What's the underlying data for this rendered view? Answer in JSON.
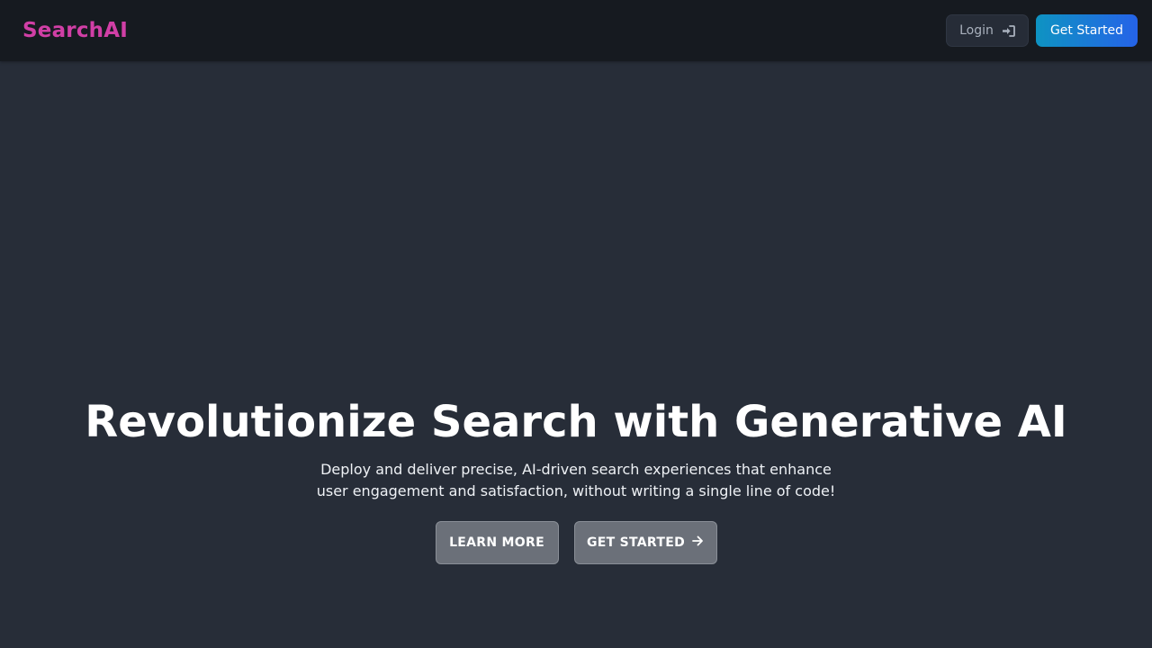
{
  "navbar": {
    "brand": "SearchAI",
    "login_label": "Login",
    "login_icon": "sign-in-icon",
    "get_started_label": "Get Started"
  },
  "hero": {
    "title": "Revolutionize Search with Generative AI",
    "subtitle": "Deploy and deliver precise, AI-driven search experiences that enhance user engagement and satisfaction, without writing a single line of code!",
    "learn_more_label": "LEARN MORE",
    "get_started_label": "GET STARTED",
    "get_started_icon": "arrow-right-icon"
  },
  "colors": {
    "brand": "#d13fa6",
    "background": "#272d38",
    "navbar": "#161a20",
    "cta_gradient_start": "#0e93c2",
    "cta_gradient_end": "#2563e8",
    "hero_button": "#6b7079"
  }
}
